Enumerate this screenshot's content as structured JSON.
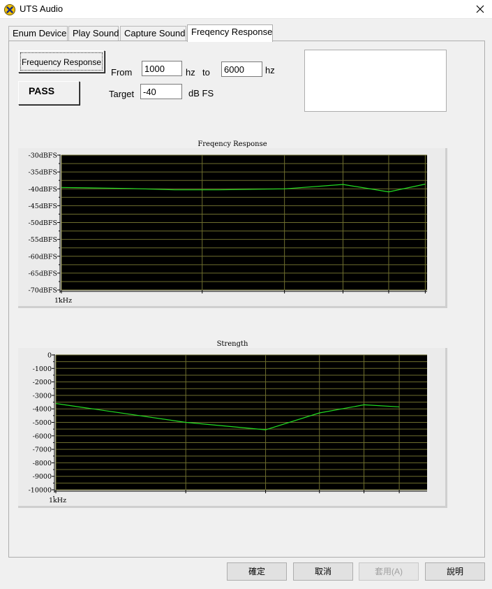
{
  "window": {
    "title": "UTS Audio",
    "accent": "#1e4bb5"
  },
  "tabs": [
    {
      "label": "Enum Device"
    },
    {
      "label": "Play Sound"
    },
    {
      "label": "Capture Sound"
    },
    {
      "label": "Freqency Response",
      "active": true
    }
  ],
  "controls": {
    "run_button": "Frequency Response",
    "result": "PASS",
    "from_label": "From",
    "from_value": "1000",
    "hz1": "hz",
    "to_label": "to",
    "to_value": "6000",
    "hz2": "hz",
    "target_label": "Target",
    "target_value": "-40",
    "target_unit": "dB FS"
  },
  "chart_data": [
    {
      "type": "line",
      "title": "Freqency Response",
      "ylim": [
        -70,
        -30
      ],
      "y_ticks": [
        "-30dBFS",
        "-35dBFS",
        "-40dBFS",
        "-45dBFS",
        "-50dBFS",
        "-55dBFS",
        "-60dBFS",
        "-65dBFS",
        "-70dBFS"
      ],
      "x_start_label": "1kHz",
      "x_gridlines": [
        0,
        0.385,
        0.61,
        0.77,
        0.895,
        0.995
      ],
      "series": [
        {
          "color": "#22dd22",
          "x": [
            0,
            0.19,
            0.31,
            0.43,
            0.61,
            0.77,
            0.895,
            0.995
          ],
          "y": [
            -39.6,
            -39.9,
            -40.3,
            -40.3,
            -40.0,
            -38.7,
            -40.9,
            -38.6
          ]
        }
      ],
      "grid": true,
      "background": "#000000",
      "grid_color": "#6e6e2e"
    },
    {
      "type": "line",
      "title": "Strength",
      "ylim": [
        -10000,
        0
      ],
      "y_ticks": [
        "0",
        "-1000",
        "-2000",
        "-3000",
        "-4000",
        "-5000",
        "-6000",
        "-7000",
        "-8000",
        "-9000",
        "-10000"
      ],
      "x_start_label": "1kHz",
      "x_gridlines": [
        0,
        0.35,
        0.565,
        0.71,
        0.83,
        0.925
      ],
      "series": [
        {
          "color": "#22dd22",
          "x": [
            0,
            0.35,
            0.565,
            0.71,
            0.83,
            0.925
          ],
          "y": [
            -3600,
            -5000,
            -5550,
            -4300,
            -3700,
            -3850
          ]
        }
      ],
      "grid": true,
      "background": "#000000",
      "grid_color": "#6e6e2e"
    }
  ],
  "footer": {
    "ok": "確定",
    "cancel": "取消",
    "apply": "套用(A)",
    "help": "說明"
  }
}
